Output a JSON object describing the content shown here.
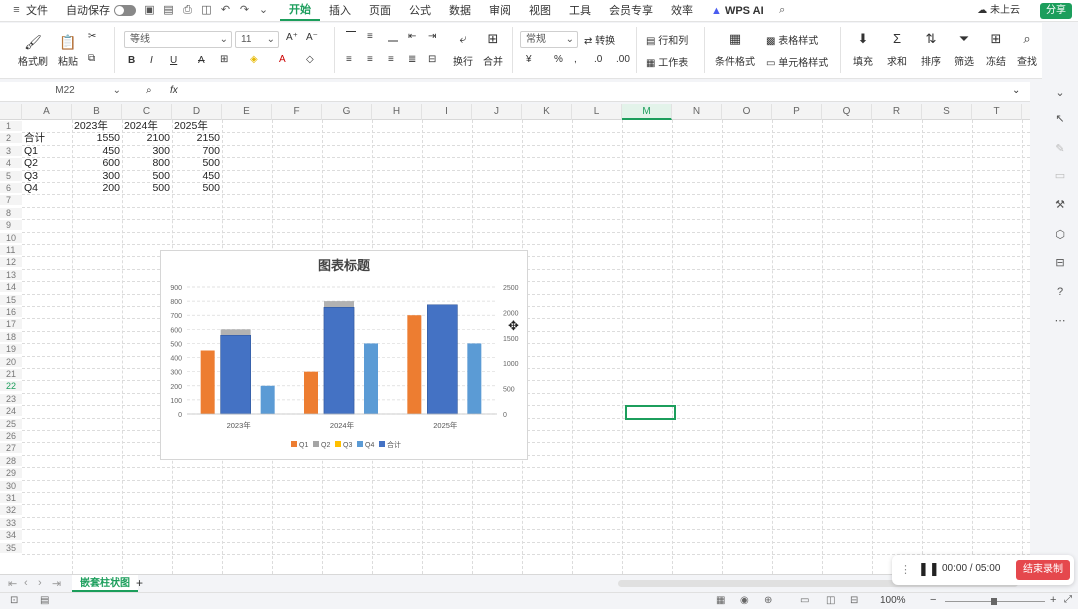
{
  "menubar": {
    "file": "文件",
    "autosave": "自动保存",
    "tabs": [
      "开始",
      "插入",
      "页面",
      "公式",
      "数据",
      "审阅",
      "视图",
      "工具",
      "会员专享",
      "效率"
    ],
    "active_tab": "开始",
    "wps_ai": "WPS AI",
    "cloud": "未上云",
    "share": "分享"
  },
  "ribbon": {
    "format_painter": "格式刷",
    "paste": "粘贴",
    "font_name": "等线",
    "font_size": "11",
    "wrap": "换行",
    "merge": "合并",
    "number_format": "常规",
    "convert": "转换",
    "rows_cols": "行和列",
    "worksheet": "工作表",
    "cond_format": "条件格式",
    "table_style": "表格样式",
    "cell_style": "单元格样式",
    "fill": "填充",
    "sum": "求和",
    "sort": "排序",
    "filter": "筛选",
    "freeze": "冻结",
    "find": "查找"
  },
  "formula_bar": {
    "name_box": "M22",
    "fx": "fx",
    "formula": ""
  },
  "sheet": {
    "columns": [
      "A",
      "B",
      "C",
      "D",
      "E",
      "F",
      "G",
      "H",
      "I",
      "J",
      "K",
      "L",
      "M",
      "N",
      "O",
      "P",
      "Q",
      "R",
      "S",
      "T"
    ],
    "selected_column": "M",
    "selected_row": "22",
    "rows": [
      "1",
      "2",
      "3",
      "4",
      "5",
      "6",
      "7",
      "8",
      "9",
      "10",
      "11",
      "12",
      "13",
      "14",
      "15",
      "16",
      "17",
      "18",
      "19",
      "20",
      "21",
      "22",
      "23",
      "24",
      "25",
      "26",
      "27",
      "28",
      "29",
      "30",
      "31",
      "32",
      "33",
      "34",
      "35"
    ],
    "header_row": [
      "",
      "2023年",
      "2024年",
      "2025年"
    ],
    "data": [
      [
        "合计",
        "1550",
        "2100",
        "2150"
      ],
      [
        "Q1",
        "450",
        "300",
        "700"
      ],
      [
        "Q2",
        "600",
        "800",
        "500"
      ],
      [
        "Q3",
        "300",
        "500",
        "450"
      ],
      [
        "Q4",
        "200",
        "500",
        "500"
      ]
    ]
  },
  "chart_data": {
    "type": "bar",
    "title": "图表标题",
    "categories": [
      "2023年",
      "2024年",
      "2025年"
    ],
    "series": [
      {
        "name": "Q1",
        "values": [
          450,
          300,
          700
        ],
        "color": "#ed7d31",
        "axis": "left",
        "slot": 0
      },
      {
        "name": "Q2",
        "values": [
          600,
          800,
          500
        ],
        "color": "#a5a5a5",
        "axis": "left",
        "slot": 1
      },
      {
        "name": "Q3",
        "values": [
          300,
          500,
          450
        ],
        "color": "#ffc000",
        "axis": "left",
        "slot": 1
      },
      {
        "name": "Q4",
        "values": [
          200,
          500,
          500
        ],
        "color": "#5b9bd5",
        "axis": "left",
        "slot": 2
      },
      {
        "name": "合计",
        "values": [
          1550,
          2100,
          2150
        ],
        "color": "#4472c4",
        "axis": "right",
        "slot": 1
      }
    ],
    "ylim": [
      0,
      900
    ],
    "yticks": [
      "0",
      "100",
      "200",
      "300",
      "400",
      "500",
      "600",
      "700",
      "800",
      "900"
    ],
    "y2lim": [
      0,
      2500
    ],
    "y2ticks": [
      "0",
      "500",
      "1000",
      "1500",
      "2000",
      "2500"
    ],
    "legend": "bottom",
    "grid": true
  },
  "sheet_tabs": {
    "active": "嵌套柱状图",
    "add": "+"
  },
  "status": {
    "zoom": "100%"
  },
  "recorder": {
    "time": "00:00 / 05:00",
    "stop": "结束录制"
  }
}
